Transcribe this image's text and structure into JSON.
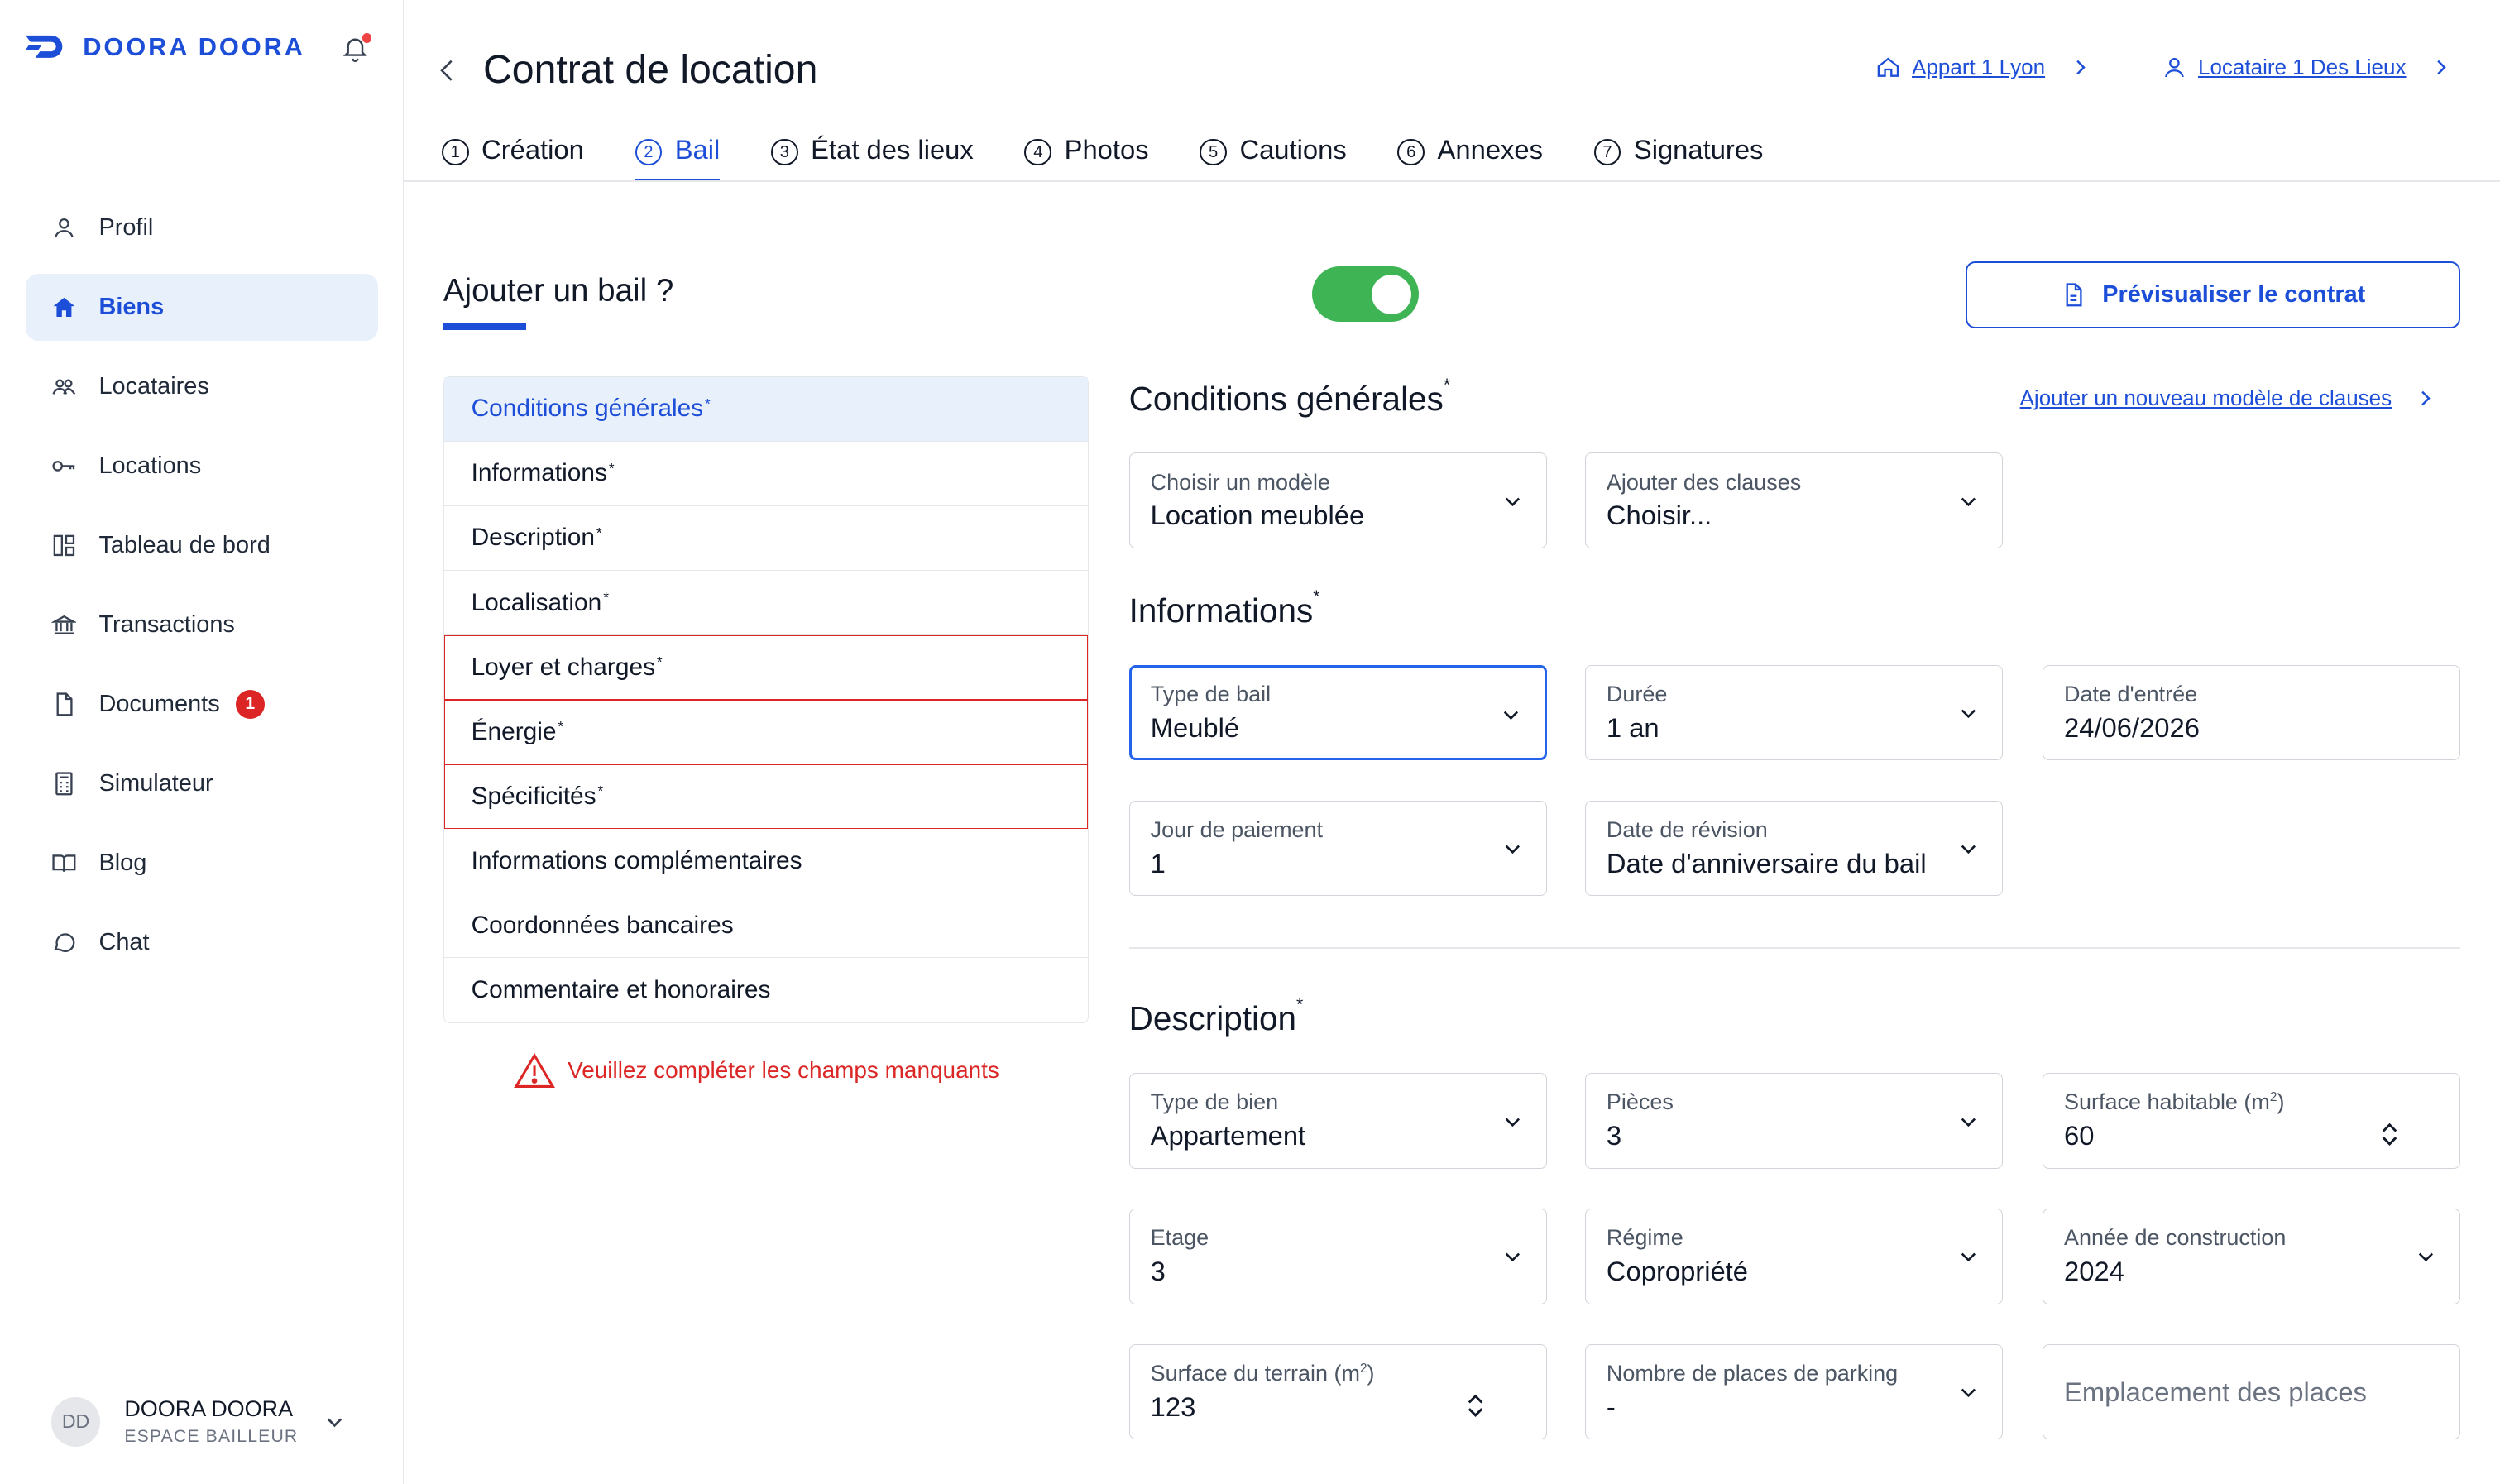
{
  "brand": {
    "name": "DOORA DOORA"
  },
  "sidebar": {
    "items": [
      {
        "label": "Profil",
        "icon": "user-icon",
        "active": false
      },
      {
        "label": "Biens",
        "icon": "home-icon",
        "active": true
      },
      {
        "label": "Locataires",
        "icon": "users-icon",
        "active": false
      },
      {
        "label": "Locations",
        "icon": "key-icon",
        "active": false
      },
      {
        "label": "Tableau de bord",
        "icon": "dashboard-icon",
        "active": false
      },
      {
        "label": "Transactions",
        "icon": "bank-icon",
        "active": false
      },
      {
        "label": "Documents",
        "icon": "document-icon",
        "active": false,
        "badge": "1"
      },
      {
        "label": "Simulateur",
        "icon": "calculator-icon",
        "active": false
      },
      {
        "label": "Blog",
        "icon": "book-icon",
        "active": false
      },
      {
        "label": "Chat",
        "icon": "chat-icon",
        "active": false
      }
    ],
    "user": {
      "initials": "DD",
      "name": "DOORA DOORA",
      "role": "ESPACE BAILLEUR"
    }
  },
  "header": {
    "title": "Contrat de location",
    "crumbs": [
      {
        "label": "Appart 1 Lyon",
        "icon": "home-icon"
      },
      {
        "label": "Locataire 1 Des Lieux",
        "icon": "user-icon"
      }
    ]
  },
  "tabs": [
    {
      "num": "1",
      "label": "Création",
      "active": false
    },
    {
      "num": "2",
      "label": "Bail",
      "active": true
    },
    {
      "num": "3",
      "label": "État des lieux",
      "active": false
    },
    {
      "num": "4",
      "label": "Photos",
      "active": false
    },
    {
      "num": "5",
      "label": "Cautions",
      "active": false
    },
    {
      "num": "6",
      "label": "Annexes",
      "active": false
    },
    {
      "num": "7",
      "label": "Signatures",
      "active": false
    }
  ],
  "bail": {
    "question": "Ajouter un bail ?",
    "toggle_on": true,
    "preview_label": "Prévisualiser le contrat",
    "sections": [
      {
        "label": "Conditions générales",
        "required": true,
        "active": true,
        "error": false
      },
      {
        "label": "Informations",
        "required": true,
        "active": false,
        "error": false
      },
      {
        "label": "Description",
        "required": true,
        "active": false,
        "error": false
      },
      {
        "label": "Localisation",
        "required": true,
        "active": false,
        "error": false
      },
      {
        "label": "Loyer et charges",
        "required": true,
        "active": false,
        "error": true
      },
      {
        "label": "Énergie",
        "required": true,
        "active": false,
        "error": true
      },
      {
        "label": "Spécificités",
        "required": true,
        "active": false,
        "error": true
      },
      {
        "label": "Informations complémentaires",
        "required": false,
        "active": false,
        "error": false
      },
      {
        "label": "Coordonnées bancaires",
        "required": false,
        "active": false,
        "error": false
      },
      {
        "label": "Commentaire et honoraires",
        "required": false,
        "active": false,
        "error": false
      }
    ],
    "warning": "Veuillez compléter les champs manquants"
  },
  "form": {
    "conditions": {
      "title": "Conditions générales",
      "add_model_link": "Ajouter un nouveau modèle de clauses",
      "modele": {
        "label": "Choisir un modèle",
        "value": "Location meublée"
      },
      "clauses": {
        "label": "Ajouter des clauses",
        "value": "Choisir..."
      }
    },
    "informations": {
      "title": "Informations",
      "type_bail": {
        "label": "Type de bail",
        "value": "Meublé"
      },
      "duree": {
        "label": "Durée",
        "value": "1 an"
      },
      "date_entree": {
        "label": "Date d'entrée",
        "value": "24/06/2026"
      },
      "jour_paiement": {
        "label": "Jour de paiement",
        "value": "1"
      },
      "date_revision": {
        "label": "Date de révision",
        "value": "Date d'anniversaire du bail"
      }
    },
    "description": {
      "title": "Description",
      "type_bien": {
        "label": "Type de bien",
        "value": "Appartement"
      },
      "pieces": {
        "label": "Pièces",
        "value": "3"
      },
      "surface_habitable": {
        "label": "Surface habitable (m",
        "label_sup": "2",
        "label_end": ")",
        "value": "60"
      },
      "etage": {
        "label": "Etage",
        "value": "3"
      },
      "regime": {
        "label": "Régime",
        "value": "Copropriété"
      },
      "annee": {
        "label": "Année de construction",
        "value": "2024"
      },
      "surface_terrain": {
        "label": "Surface du terrain (m",
        "label_sup": "2",
        "label_end": ")",
        "value": "123"
      },
      "parking": {
        "label": "Nombre de places de parking",
        "value": "-"
      },
      "emplacement": {
        "placeholder": "Emplacement des places"
      }
    }
  },
  "colors": {
    "accent": "#1d4ed8",
    "toggle": "#3fb454",
    "error": "#dc2626",
    "active_bg": "#e8f0fc"
  }
}
